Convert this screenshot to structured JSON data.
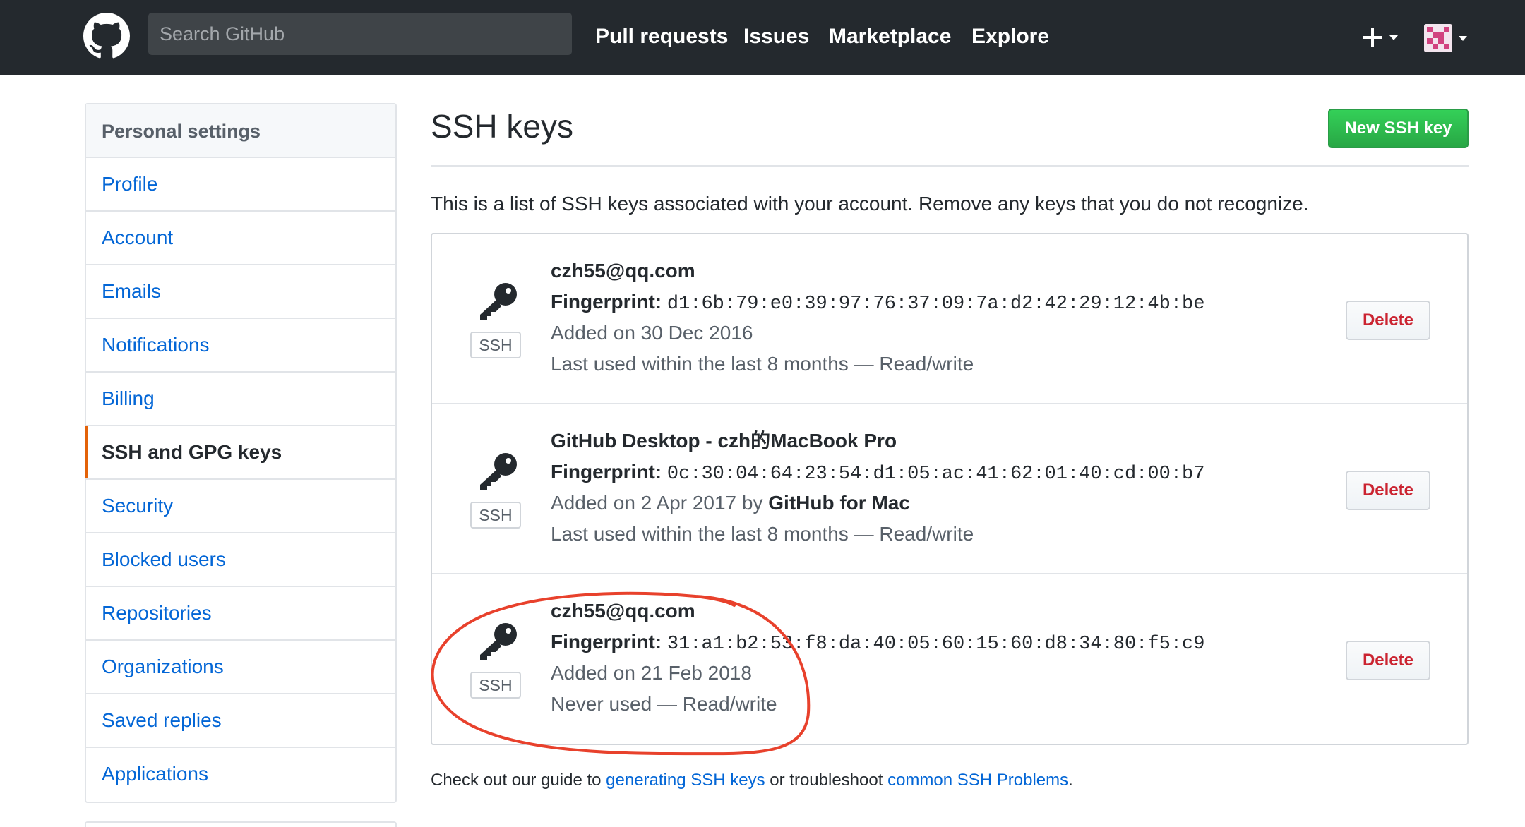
{
  "header": {
    "search_placeholder": "Search GitHub",
    "nav": [
      "Pull requests",
      "Issues",
      "Marketplace",
      "Explore"
    ],
    "plus_icon": "plus-icon",
    "avatar_icon": "avatar"
  },
  "sidebar": {
    "heading": "Personal settings",
    "items": [
      {
        "label": "Profile"
      },
      {
        "label": "Account"
      },
      {
        "label": "Emails"
      },
      {
        "label": "Notifications"
      },
      {
        "label": "Billing"
      },
      {
        "label": "SSH and GPG keys",
        "active": true
      },
      {
        "label": "Security"
      },
      {
        "label": "Blocked users"
      },
      {
        "label": "Repositories"
      },
      {
        "label": "Organizations"
      },
      {
        "label": "Saved replies"
      },
      {
        "label": "Applications"
      }
    ]
  },
  "main": {
    "title": "SSH keys",
    "new_button": "New SSH key",
    "intro": "This is a list of SSH keys associated with your account. Remove any keys that you do not recognize.",
    "keys": [
      {
        "name": "czh55@qq.com",
        "fingerprint_label": "Fingerprint:",
        "fingerprint": "d1:6b:79:e0:39:97:76:37:09:7a:d2:42:29:12:4b:be",
        "added": "Added on 30 Dec 2016",
        "added_by_prefix": "",
        "added_by": "",
        "usage": "Last used within the last 8 months — Read/write",
        "badge": "SSH",
        "delete": "Delete"
      },
      {
        "name": "GitHub Desktop - czh的MacBook Pro",
        "fingerprint_label": "Fingerprint:",
        "fingerprint": "0c:30:04:64:23:54:d1:05:ac:41:62:01:40:cd:00:b7",
        "added": "Added on 2 Apr 2017",
        "added_by_prefix": " by ",
        "added_by": "GitHub for Mac",
        "usage": "Last used within the last 8 months — Read/write",
        "badge": "SSH",
        "delete": "Delete"
      },
      {
        "name": "czh55@qq.com",
        "fingerprint_label": "Fingerprint:",
        "fingerprint": "31:a1:b2:53:f8:da:40:05:60:15:60:d8:34:80:f5:c9",
        "added": "Added on 21 Feb 2018",
        "added_by_prefix": "",
        "added_by": "",
        "usage": "Never used — Read/write",
        "badge": "SSH",
        "delete": "Delete"
      }
    ],
    "guide": {
      "prefix": "Check out our guide to ",
      "link1": "generating SSH keys",
      "middle": " or troubleshoot ",
      "link2": "common SSH Problems",
      "suffix": "."
    }
  },
  "colors": {
    "header_bg": "#24292e",
    "link": "#0366d6",
    "primary_button": "#28a745",
    "danger_text": "#cb2431",
    "active_marker": "#e36209",
    "annotation": "#e8412c"
  }
}
